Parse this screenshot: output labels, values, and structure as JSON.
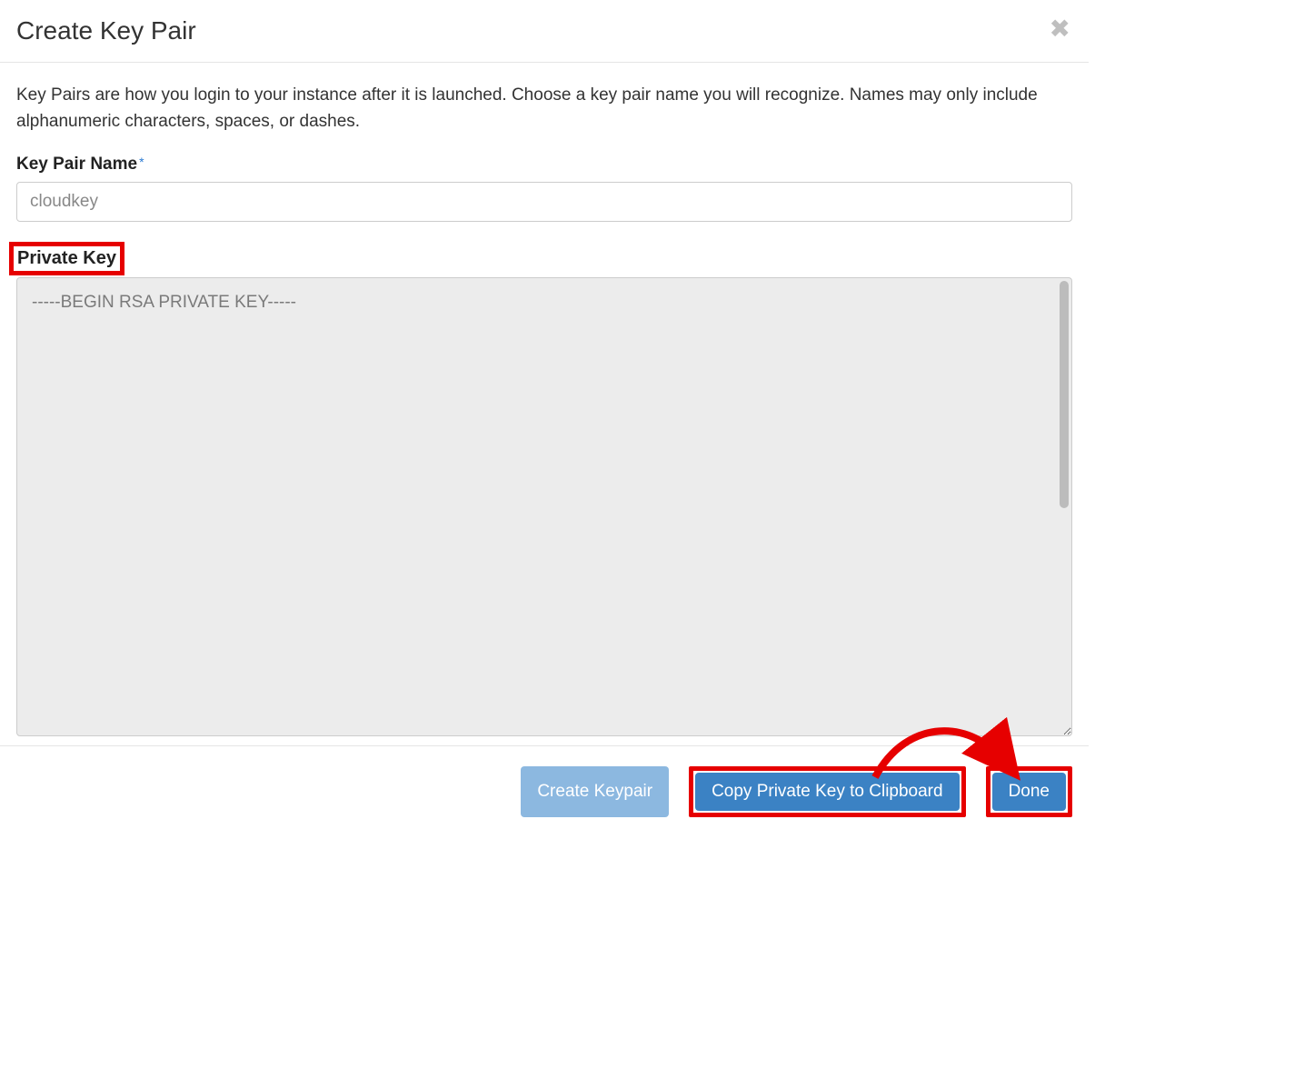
{
  "header": {
    "title": "Create Key Pair"
  },
  "body": {
    "description": "Key Pairs are how you login to your instance after it is launched. Choose a key pair name you will recognize. Names may only include alphanumeric characters, spaces, or dashes.",
    "name_label": "Key Pair Name",
    "name_value": "cloudkey",
    "private_key_label": "Private Key",
    "private_key_value": "-----BEGIN RSA PRIVATE KEY-----"
  },
  "footer": {
    "create_label": "Create Keypair",
    "copy_label": "Copy Private Key to Clipboard",
    "done_label": "Done"
  }
}
